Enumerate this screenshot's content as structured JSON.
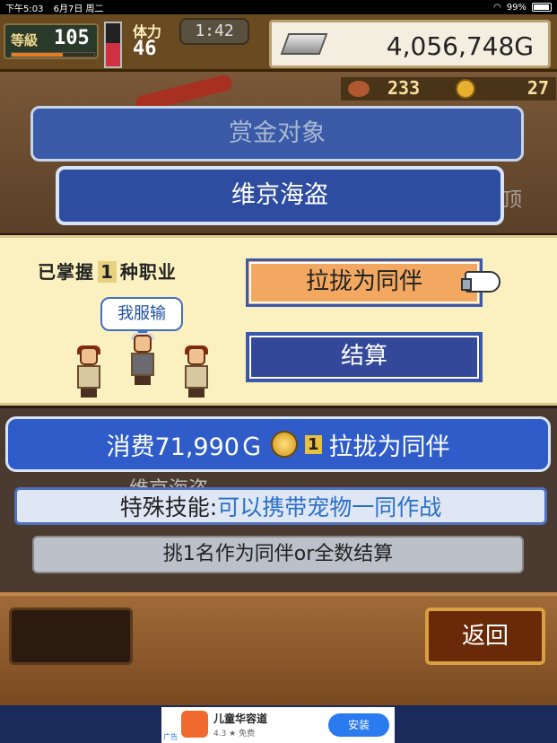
{
  "status_bar": {
    "time": "下午5:03",
    "date": "6月7日 周二",
    "battery": "99%"
  },
  "hud": {
    "level_label": "等級",
    "level_value": "105",
    "level_progress": 0.62,
    "stamina_label": "体力",
    "stamina_value": "46",
    "stamina_level": 0.55,
    "timer": "1:42",
    "money": "4,056,748G",
    "sub_value_1": "233",
    "sub_value_2": "27"
  },
  "panel": {
    "bounty_title": "赏金对象",
    "target_name": "维京海盗",
    "ghost_text": "顶"
  },
  "choice": {
    "jobs_prefix": "已掌握",
    "jobs_count": "1",
    "jobs_suffix": "种职业",
    "speech": "我服输",
    "recruit_button": "拉拢为同伴",
    "settle_button": "结算"
  },
  "cost": {
    "prefix": "消费71,990Ｇ",
    "coin_count": "1",
    "suffix": "拉拢为同伴"
  },
  "ghost_name": "维京海盗",
  "skill": {
    "label": "特殊技能:",
    "value": "可以携带宠物一同作战"
  },
  "hint": "挑1名作为同伴or全数结算",
  "back_button": "返回",
  "ad": {
    "title": "儿童华容道",
    "rating": "4.3 ★ 免费",
    "install": "安装",
    "tag": "广告"
  }
}
